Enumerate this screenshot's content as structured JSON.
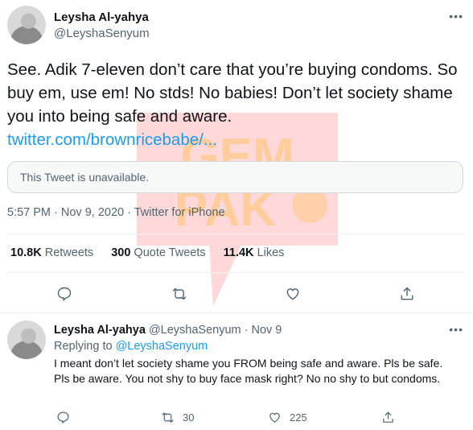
{
  "tweet": {
    "author_name": "Leysha Al-yahya",
    "author_handle": "@LeyshaSenyum",
    "more": "•••",
    "text": "See. Adik 7-eleven don’t care that you’re buying condoms. So buy em, use em! No stds! No babies! Don’t let society shame you into being safe and aware.",
    "link": "twitter.com/brownricebabe/...",
    "quoted_unavailable": "This Tweet is unavailable.",
    "meta": "5:57 PM · Nov 9, 2020 · Twitter for iPhone",
    "stats": {
      "retweets_value": "10.8K",
      "retweets_label": "Retweets",
      "quotes_value": "300",
      "quotes_label": "Quote Tweets",
      "likes_value": "11.4K",
      "likes_label": "Likes"
    },
    "icons": [
      "reply-icon",
      "retweet-icon",
      "like-icon",
      "share-icon"
    ]
  },
  "reply": {
    "author_name": "Leysha Al-yahya",
    "author_handle_date": "@LeyshaSenyum · Nov 9",
    "more": "•••",
    "replying_prefix": "Replying to",
    "replying_handle": "@LeyshaSenyum",
    "text": "I meant don’t let society shame you FROM being safe and aware. Pls be safe. Pls be aware. You not shy to buy face mask right? No no shy to but condoms.",
    "retweet_count": "30",
    "like_count": "225"
  },
  "watermark": {
    "line1": "GEM",
    "line2": "PAK",
    "color": "#ff2b2b"
  }
}
